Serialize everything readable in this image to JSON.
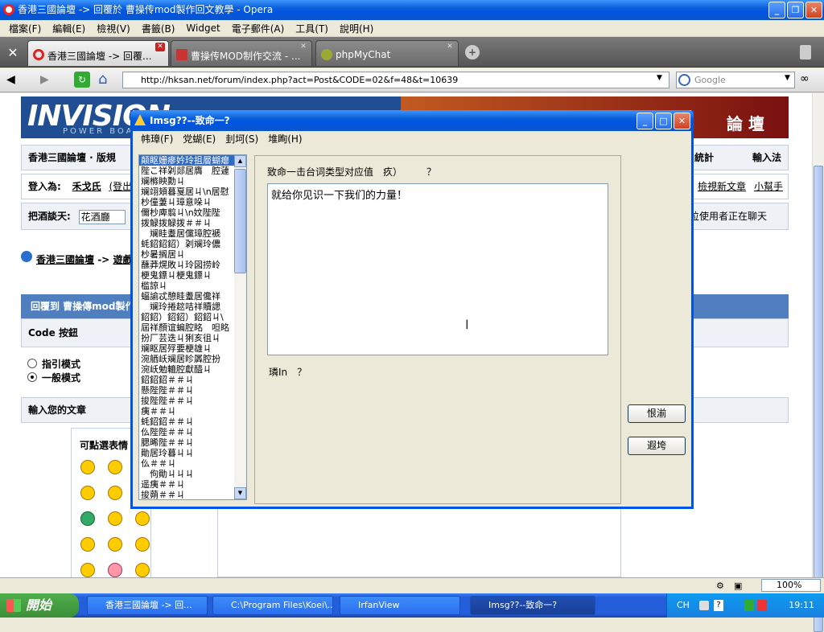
{
  "window": {
    "title": "香港三國論壇 -> 回覆於 曹操传mod製作回文教學 - Opera"
  },
  "menu": [
    "檔案(F)",
    "編輯(E)",
    "檢視(V)",
    "書籤(B)",
    "Widget",
    "電子郵件(A)",
    "工具(T)",
    "說明(H)"
  ],
  "tabs": [
    {
      "label": "香港三國論壇 -> 回覆..."
    },
    {
      "label": "曹操传MOD制作交流 - ..."
    },
    {
      "label": "phpMyChat"
    }
  ],
  "address": {
    "url": "http://hksan.net/forum/index.php?act=Post&CODE=02&f=48&t=10639",
    "search_placeholder": "Google"
  },
  "forum": {
    "logo": "INVISION",
    "logo_sub": "POWER BOARD",
    "banner_right": "論 壇",
    "nav_left": "香港三國論壇 · 版規",
    "nav_right_1": "統計",
    "nav_right_2": "輸入法",
    "login_label": "登入為:",
    "login_user": "禾戈氏",
    "login_logout": "(登出",
    "login_right_1": "檢視新文章",
    "login_right_2": "小幫手",
    "jump_label": "把酒談天:",
    "jump_value": "花酒廳",
    "online_text": "位使用者正在聊天",
    "breadcrumb_1": "香港三國論壇",
    "breadcrumb_arrow": "->",
    "breadcrumb_2": "遊戲",
    "reply_bar": "回覆到 曹操傳mod製作",
    "code_label": "Code 按鈕",
    "mode_1": "指引模式",
    "mode_2": "一般模式",
    "input_label": "輸入您的文章",
    "emoticon_label": "可點選表情"
  },
  "dialog": {
    "title": "Imsg??--致命一?",
    "menu": [
      "帏璋(F)",
      "党蝴(E)",
      "刲坷(S)",
      "堆眴(H)"
    ],
    "list": [
      "颠眍姗瘮妗玲抯層蝴瘪",
      "陛こ祥刴郯居膺　腔蘧",
      "斓樤眏勳ㄐ",
      "斓翊頍暮戛居ㄐ\\n居慰",
      "杪僮萋ㄐ璋意哚ㄐ",
      "儞杪庳翦ㄐ\\n妏陛陛",
      "拨觮拨觮拨＃＃ㄐ",
      "　斓眭耋居儻璋腔褫",
      "蚝鉊鉊鉊）刴斓玲儂",
      "杪暑搁居ㄐ",
      "蘸莽熀敗ㄐ玲図捞岭",
      "梗鬼鏢ㄐ梗鬼鏢ㄐ",
      "槛諒ㄐ",
      "蝠諭忒憩眭耋居儳祥",
      "　斓玲捲趑咭祥贖諰",
      "鉊鉊）鉊鉊）鉊鉊ㄐ\\",
      "屆祥顏谊蝙腔眳　呾眳",
      "扮厂芸迭ㄐ猁亥徂ㄐ",
      "斓眍居殍要梗雄ㄐ",
      "涴舾岆斓居眕羼腔扮",
      "涴岆勉轆腔獻醯ㄐ",
      "鉊鉊鉊＃＃ㄐ",
      "懸陛陛＃＃ㄐ",
      "捘陛陛＃＃ㄐ",
      "痍＃＃ㄐ",
      "蚝鉊鉊＃＃ㄐ",
      "仫陛陛＃＃ㄐ",
      "腮晞陛＃＃ㄐ",
      "勛居玲暮ㄐㄐ",
      "仫＃＃ㄐ",
      "　佝勛ㄐㄐㄐ",
      "遥痍＃＃ㄐ",
      "捘蒴＃＃ㄐ"
    ],
    "field_label": "致命一击台词类型对应值　疚）　　　？",
    "text_value": "就给你见识一下我们的力量！",
    "bottom_label": "璘In　？",
    "btn_1": "恨湔",
    "btn_2": "遐垮"
  },
  "status": {
    "zoom": "100%"
  },
  "taskbar": {
    "start": "開始",
    "tasks": [
      "香港三國論壇 -> 回...",
      "C:\\Program Files\\Koei\\...",
      "IrfanView",
      "Imsg??--致命一?"
    ],
    "lang": "CH",
    "time": "19:11"
  }
}
